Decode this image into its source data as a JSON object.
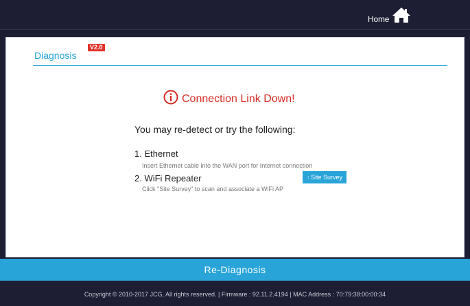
{
  "header": {
    "home_label": "Home",
    "home_icon": "home-icon"
  },
  "panel": {
    "title": "Diagnosis",
    "version": "V2.0",
    "status_icon": "info-circle-icon",
    "status_text": "Connection Link Down!",
    "intro": "You may re-detect or try the following:",
    "options": [
      {
        "title": "1. Ethernet",
        "desc": "Insert Ethernet cable into the WAN port for Internet connection"
      },
      {
        "title": "2. WiFi Repeater",
        "desc": "Click \"Site Survey\" to scan and associate a WiFi AP"
      }
    ],
    "site_survey_label": "Site Survey"
  },
  "actions": {
    "rediagnosis_label": "Re-Diagnosis"
  },
  "footer": {
    "text": "Copyright © 2010-2017 JCG, All rights reserved.  |  Firmware : 92.11.2.4194  |  MAC Address : 70:79:38:00:00:34"
  },
  "colors": {
    "accent": "#28a4d8",
    "error": "#d62c24",
    "background": "#1d1d33",
    "badge": "#e0322c"
  }
}
